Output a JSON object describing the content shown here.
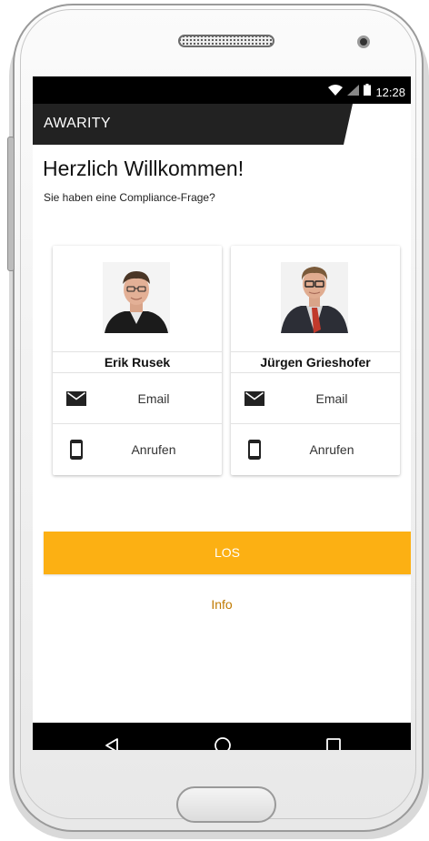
{
  "status_bar": {
    "time": "12:28",
    "icons": [
      "wifi-icon",
      "signal-icon",
      "battery-icon"
    ]
  },
  "app_bar": {
    "title": "AWARITY"
  },
  "main": {
    "welcome": "Herzlich Willkommen!",
    "subtitle": "Sie haben eine Compliance-Frage?"
  },
  "contacts": [
    {
      "name": "Erik Rusek",
      "email_label": "Email",
      "call_label": "Anrufen"
    },
    {
      "name": "Jürgen Grieshofer",
      "email_label": "Email",
      "call_label": "Anrufen"
    }
  ],
  "actions": {
    "los_label": "LOS",
    "info_label": "Info"
  },
  "nav": {
    "icons": [
      "back-icon",
      "home-icon",
      "recents-icon"
    ]
  },
  "colors": {
    "accent": "#fcb013",
    "info_link": "#c07a00",
    "app_bar": "#222222"
  }
}
